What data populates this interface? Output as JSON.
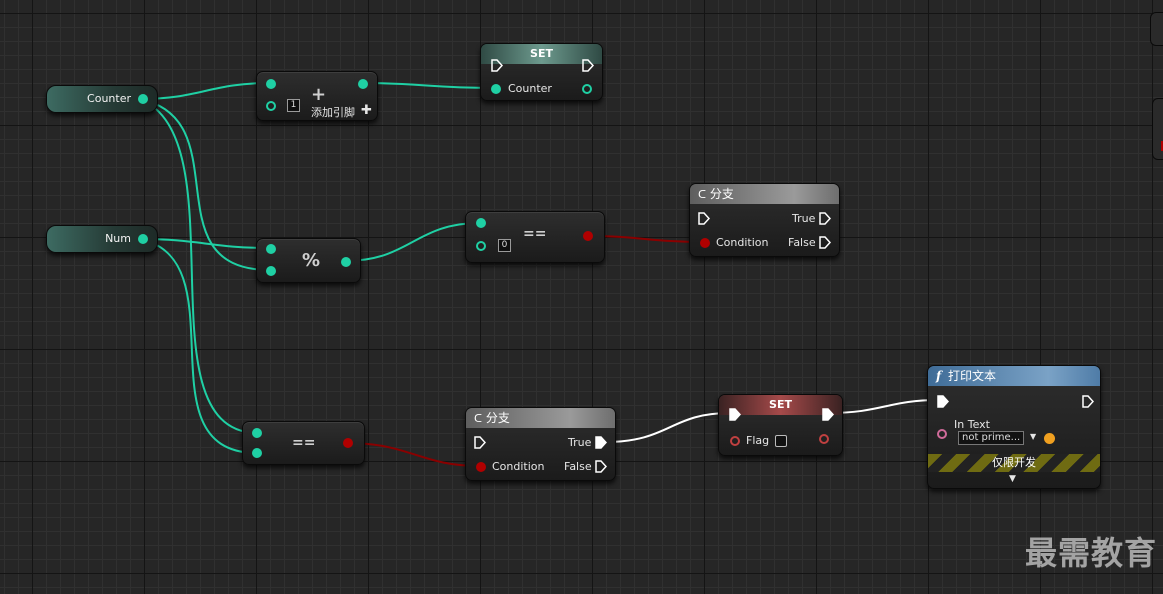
{
  "variables": {
    "counter": "Counter",
    "num": "Num"
  },
  "add_node": {
    "operator": "+",
    "literal": "1",
    "add_pin_label": "添加引脚",
    "add_pin_icon": "✚"
  },
  "set_counter": {
    "title": "SET",
    "pin_label": "Counter"
  },
  "modulo_node": {
    "operator": "%"
  },
  "equals_zero": {
    "operator": "==",
    "literal": "0"
  },
  "branch_top": {
    "title": "分支",
    "true_label": "True",
    "false_label": "False",
    "condition_label": "Condition"
  },
  "equals_bottom": {
    "operator": "=="
  },
  "branch_bottom": {
    "title": "分支",
    "true_label": "True",
    "false_label": "False",
    "condition_label": "Condition"
  },
  "set_flag": {
    "title": "SET",
    "pin_label": "Flag"
  },
  "print_text": {
    "icon": "f",
    "title": "打印文本",
    "in_text_label": "In Text",
    "in_text_value": "not prime...",
    "dev_only_label": "仅限开发",
    "expand_icon": "▼"
  },
  "watermark": "最需教育",
  "colors": {
    "float_pin": "#1fd0a4",
    "bool_pin": "#b00000",
    "exec_wire": "#ffffff",
    "text_pin": "#d06b9a"
  }
}
